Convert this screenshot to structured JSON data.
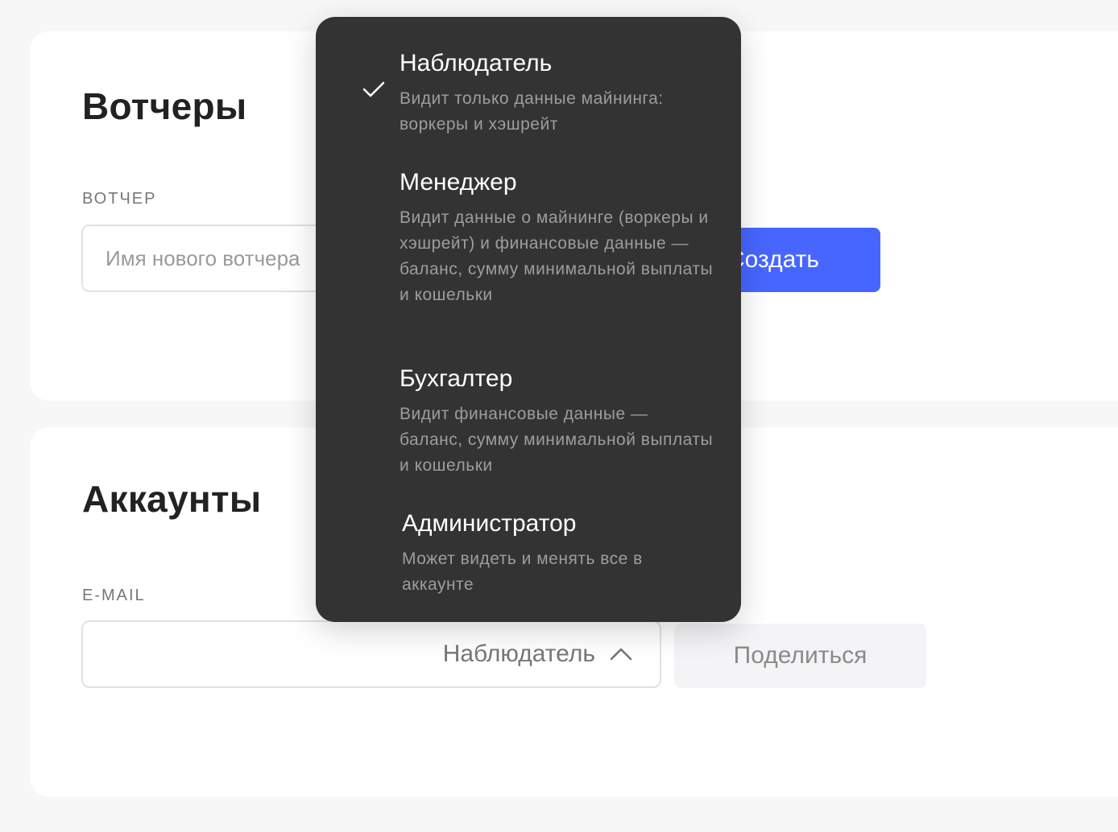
{
  "watchers": {
    "title": "Вотчеры",
    "field_label": "ВОТЧЕР",
    "input_placeholder": "Имя нового вотчера",
    "create_label": "Создать",
    "create_color": "#4766ff"
  },
  "accounts": {
    "title": "Аккаунты",
    "field_label": "E-MAIL",
    "email_value": "",
    "role_selected": "Наблюдатель",
    "share_label": "Поделиться"
  },
  "role_dropdown": {
    "selected_index": 0,
    "background": "#333333",
    "options": [
      {
        "title": "Наблюдатель",
        "description": "Видит только данные майнинга: воркеры и хэшрейт"
      },
      {
        "title": "Менеджер",
        "description": "Видит данные о майнинге (воркеры и хэшрейт) и финансовые данные — баланс, сумму минимальной выплаты и кошельки"
      },
      {
        "title": "Бухгалтер",
        "description": "Видит финансовые данные — баланс, сумму минимальной выплаты и кошельки"
      },
      {
        "title": "Администратор",
        "description": "Может видеть и менять все в аккаунте"
      }
    ]
  },
  "icons": {
    "selected_option": "check-icon",
    "select_toggle": "chevron-up-icon"
  }
}
